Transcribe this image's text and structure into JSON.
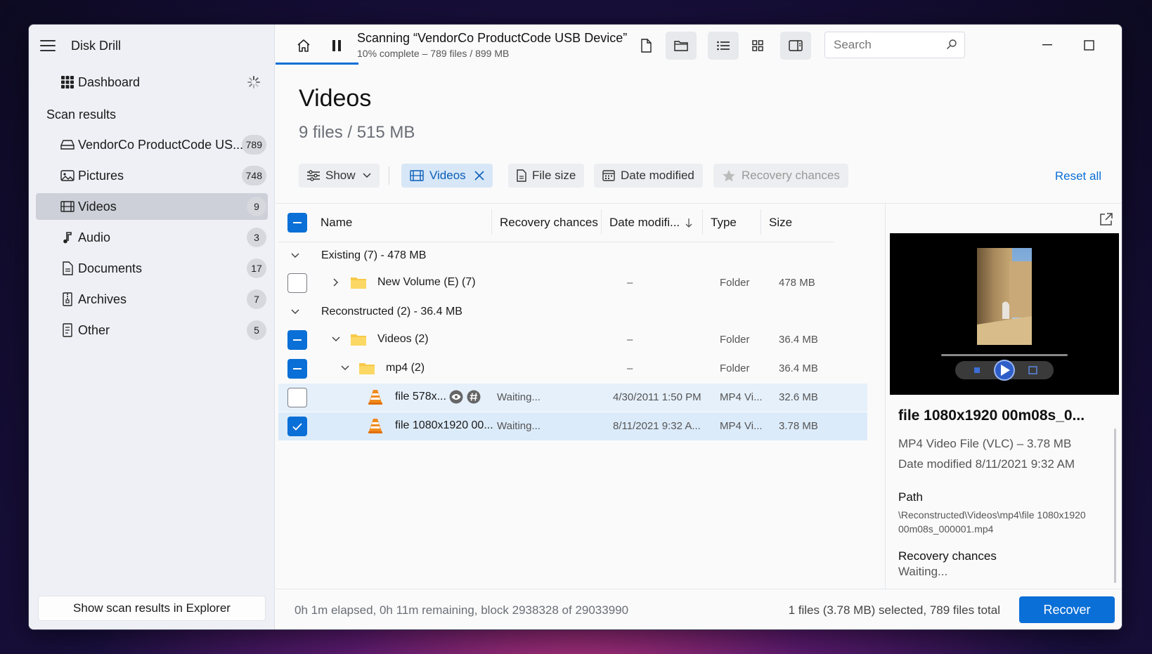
{
  "app": {
    "title": "Disk Drill"
  },
  "sidebar": {
    "dashboard_label": "Dashboard",
    "section_title": "Scan results",
    "items": [
      {
        "label": "VendorCo ProductCode US...",
        "count": "789",
        "icon": "drive-icon"
      },
      {
        "label": "Pictures",
        "count": "748",
        "icon": "pictures-icon"
      },
      {
        "label": "Videos",
        "count": "9",
        "icon": "film-icon"
      },
      {
        "label": "Audio",
        "count": "3",
        "icon": "music-note-icon"
      },
      {
        "label": "Documents",
        "count": "17",
        "icon": "document-icon"
      },
      {
        "label": "Archives",
        "count": "7",
        "icon": "archive-icon"
      },
      {
        "label": "Other",
        "count": "5",
        "icon": "other-file-icon"
      }
    ],
    "explorer_button": "Show scan results in Explorer"
  },
  "topbar": {
    "scan_title": "Scanning “VendorCo ProductCode USB Device”",
    "scan_sub": "10% complete – 789 files / 899 MB",
    "progress": 0.1,
    "search_placeholder": "Search"
  },
  "header": {
    "title": "Videos",
    "subtitle": "9 files / 515 MB"
  },
  "filters": {
    "show": "Show",
    "videos": "Videos",
    "file_size": "File size",
    "date_modified": "Date modified",
    "recovery_chances": "Recovery chances",
    "reset_all": "Reset all"
  },
  "table": {
    "columns": {
      "name": "Name",
      "recovery": "Recovery chances",
      "date": "Date modifi...",
      "type": "Type",
      "size": "Size"
    },
    "group_existing": "Existing (7) - 478 MB",
    "group_reconstructed": "Reconstructed (2) - 36.4 MB",
    "rows": [
      {
        "name": "New Volume (E) (7)",
        "recovery": "",
        "date": "–",
        "type": "Folder",
        "size": "478 MB"
      },
      {
        "name": "Videos (2)",
        "recovery": "",
        "date": "–",
        "type": "Folder",
        "size": "36.4 MB"
      },
      {
        "name": "mp4 (2)",
        "recovery": "",
        "date": "–",
        "type": "Folder",
        "size": "36.4 MB"
      },
      {
        "name": "file 578x...",
        "recovery": "Waiting...",
        "date": "4/30/2011 1:50 PM",
        "type": "MP4 Vi...",
        "size": "32.6 MB"
      },
      {
        "name": "file 1080x1920 00...",
        "recovery": "Waiting...",
        "date": "8/11/2021 9:32 A...",
        "type": "MP4 Vi...",
        "size": "3.78 MB"
      }
    ]
  },
  "preview": {
    "title": "file 1080x1920 00m08s_0...",
    "type_line": "MP4 Video File (VLC) – 3.78 MB",
    "date_line": "Date modified 8/11/2021 9:32 AM",
    "path_label": "Path",
    "path_value": "\\Reconstructed\\Videos\\mp4\\file 1080x1920 00m08s_000001.mp4",
    "recovery_label": "Recovery chances",
    "recovery_value": "Waiting..."
  },
  "status": {
    "left": "0h 1m elapsed, 0h 11m remaining, block 2938328 of 29033990",
    "right": "1 files (3.78 MB) selected, 789 files total",
    "recover_button": "Recover"
  },
  "colors": {
    "accent": "#0a6fd6",
    "sidebar_bg": "#eef0f5",
    "selected_row": "#dcebfa"
  }
}
